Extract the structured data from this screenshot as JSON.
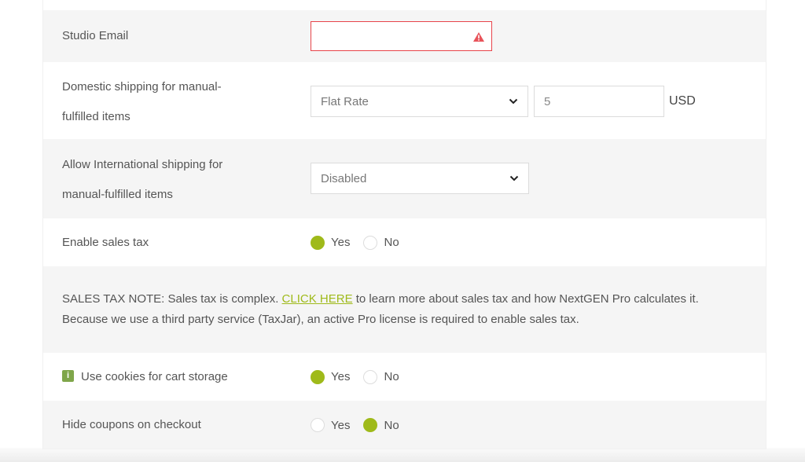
{
  "rows": {
    "studio_email": {
      "label": "Studio Email",
      "value": "",
      "state": "error"
    },
    "domestic_shipping": {
      "label_line1": "Domestic shipping for manual-",
      "label_line2": "fulfilled items",
      "method": "Flat Rate",
      "amount": "5",
      "currency": "USD"
    },
    "international_shipping": {
      "label_line1": "Allow International shipping for",
      "label_line2": "manual-fulfilled items",
      "value": "Disabled"
    },
    "sales_tax": {
      "label": "Enable sales tax",
      "yes_label": "Yes",
      "no_label": "No",
      "selected": "Yes"
    },
    "sales_tax_note": {
      "prefix": "SALES TAX NOTE: Sales tax is complex. ",
      "link_text": "CLICK HERE",
      "suffix": " to learn more about sales tax and how NextGEN Pro calculates it. Because we use a third party service (TaxJar), an active Pro license is required to enable sales tax."
    },
    "cookies_cart": {
      "info_icon": "i",
      "label": "Use cookies for cart storage",
      "yes_label": "Yes",
      "no_label": "No",
      "selected": "Yes"
    },
    "hide_coupons": {
      "label": "Hide coupons on checkout",
      "yes_label": "Yes",
      "no_label": "No",
      "selected": "No"
    }
  },
  "colors": {
    "accent": "#9fba1a",
    "error": "#e8444a",
    "row_alt": "#f5f5f5"
  }
}
